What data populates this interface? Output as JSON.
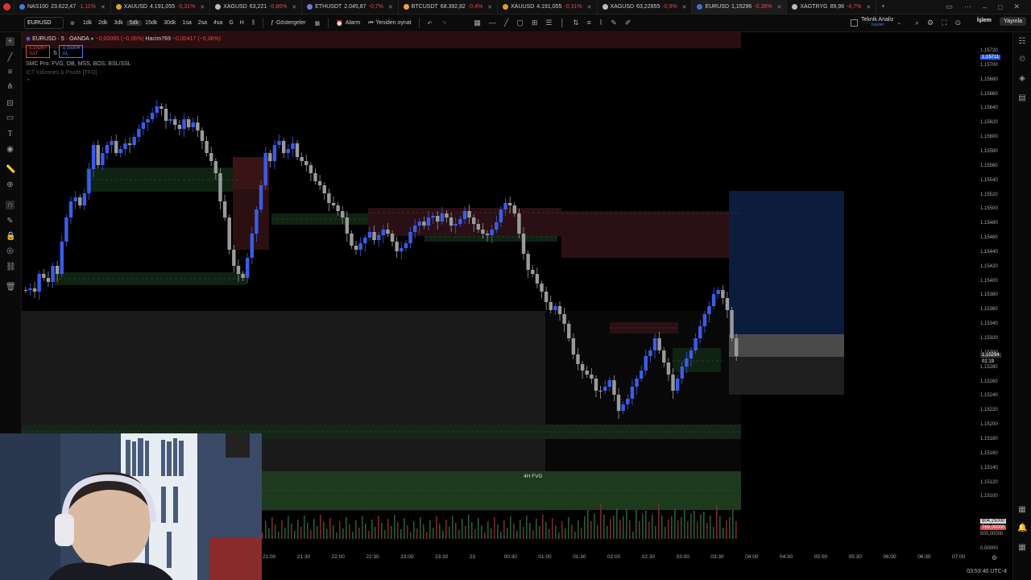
{
  "tabs": [
    {
      "symbol": "NAS100",
      "price": "23.622,47",
      "change": "-1,11%",
      "color": "#3d7be0",
      "up": false
    },
    {
      "symbol": "XAUUSD",
      "price": "4.191,055",
      "change": "-0,31%",
      "color": "#e0a020",
      "up": false
    },
    {
      "symbol": "XAGUSD",
      "price": "63,221",
      "change": "-0,86%",
      "color": "#bbbbbb",
      "up": false
    },
    {
      "symbol": "ETHUSDT",
      "price": "2.045,87",
      "change": "-0,7%",
      "color": "#6a7fd8",
      "up": false
    },
    {
      "symbol": "BTCUSDT",
      "price": "68.392,82",
      "change": "-0,4%",
      "color": "#f2a33a",
      "up": false
    },
    {
      "symbol": "XAUUSD",
      "price": "4.191,055",
      "change": "-0,31%",
      "color": "#e0a020",
      "up": false
    },
    {
      "symbol": "XAGUSD",
      "price": "63,22855",
      "change": "-0,9%",
      "color": "#bbbbbb",
      "up": false
    },
    {
      "symbol": "EURUSD",
      "price": "1,15296",
      "change": "-0,36%",
      "color": "#3f6fd0",
      "up": false,
      "active": true
    },
    {
      "symbol": "XAGTRYG",
      "price": "89,98",
      "change": "-4,7%",
      "color": "#bbbbbb",
      "up": false
    }
  ],
  "toolbar": {
    "symbol": "EURUSD",
    "timeframes": [
      "1dk",
      "2dk",
      "3dk",
      "5dk",
      "15dk",
      "30dk",
      "1sa",
      "2sa",
      "4sa",
      "G",
      "H"
    ],
    "selected_tf": "5dk",
    "indicators_label": "Göstergeler",
    "alarm_label": "Alarm",
    "replay_label": "Yeniden oynat",
    "tech_analysis_label": "Teknik Analiz",
    "tech_analysis_sub": "Kaydet",
    "trade_label": "İşlem",
    "publish_label": "Yayınla"
  },
  "legend": {
    "title": "EURUSD · 5 · OANDA",
    "change": "−0,00065 (−0,06%)",
    "volume_label": "Hacim",
    "volume_value": "769",
    "volume_change": "−0,00417 (−0,36%)",
    "sell_price": "1,15287",
    "sell_label": "SAT",
    "buy_price": "1,15304",
    "buy_label": "AL",
    "indicator1": "SMC Pro: FVG, OB, MSS, BOS, BSL/SSL",
    "indicator2": "ICT Killzones & Pivots [TFO]"
  },
  "price_axis": {
    "labels": [
      "1,15720",
      "1,15700",
      "1,15680",
      "1,15660",
      "1,15640",
      "1,15620",
      "1,15600",
      "1,15580",
      "1,15560",
      "1,15540",
      "1,15520",
      "1,15500",
      "1,15480",
      "1,15460",
      "1,15440",
      "1,15420",
      "1,15400",
      "1,15380",
      "1,15360",
      "1,15340",
      "1,15320",
      "1,15300",
      "1,15280",
      "1,15260",
      "1,15240",
      "1,15220",
      "1,15200",
      "1,15180",
      "1,15160",
      "1,15140",
      "1,15120",
      "1,15100"
    ],
    "current_price": "1,15711",
    "last_price": "1,15294",
    "countdown": "01:19",
    "vol_high": "804,25000",
    "vol_current": "769,00000",
    "vol_mid": "500,00000",
    "vol_zero": "0,00000"
  },
  "time_axis": {
    "labels": [
      "21:00",
      "21:30",
      "22:00",
      "22:30",
      "23:00",
      "23:30",
      "23",
      "00:30",
      "01:00",
      "01:30",
      "02:00",
      "02:30",
      "03:00",
      "03:30",
      "04:00",
      "04:30",
      "05:00",
      "05:30",
      "06:00",
      "06:30",
      "07:00"
    ]
  },
  "fvg_label": "4H FVG",
  "clock": "03:53:40 UTC-4",
  "colors": {
    "bull": "#3a5ce8",
    "bear": "#9a9a9a",
    "fvg_green": "#1f3a1f",
    "ob_red": "#3a1414",
    "accent": "#2962ff"
  }
}
